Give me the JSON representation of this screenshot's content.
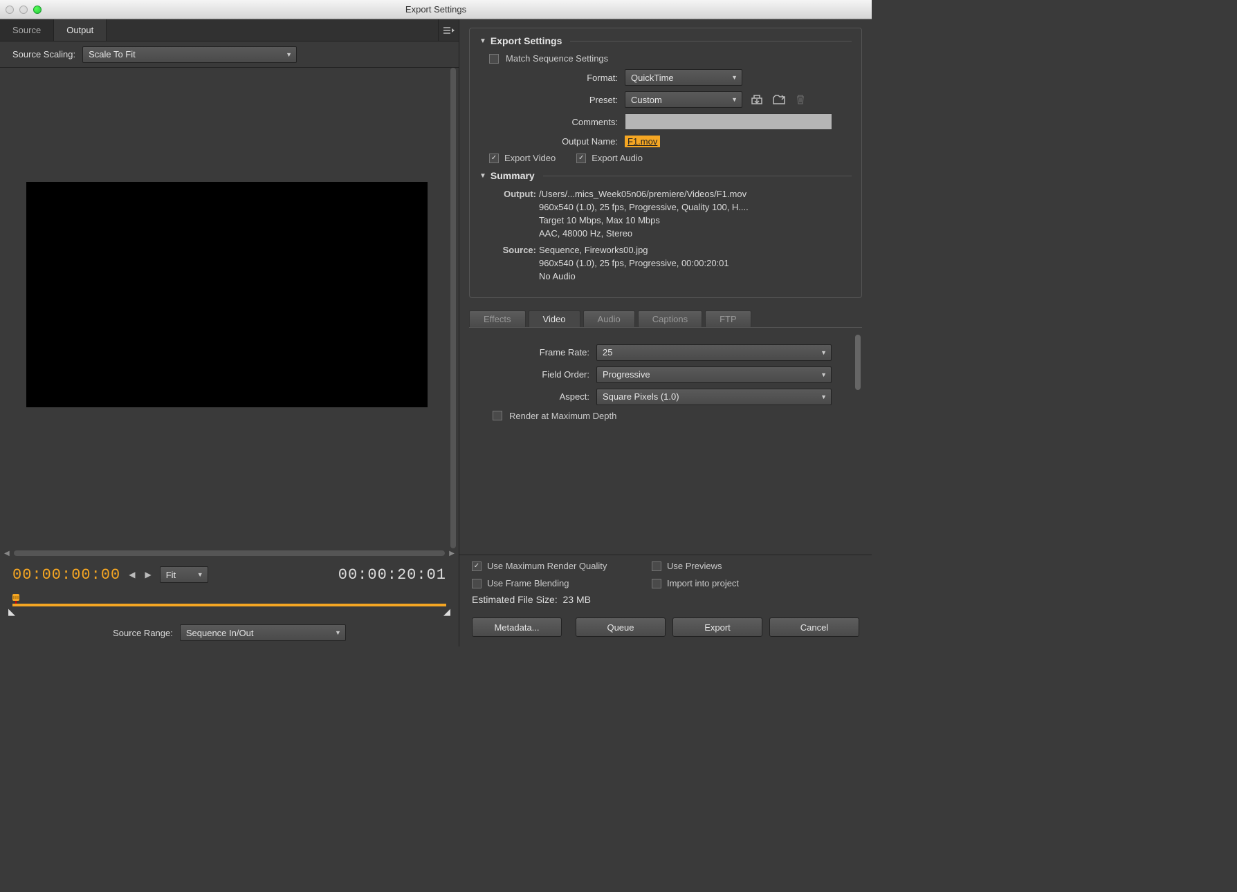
{
  "window": {
    "title": "Export Settings"
  },
  "left": {
    "tabs": {
      "source": "Source",
      "output": "Output"
    },
    "scaling_label": "Source Scaling:",
    "scaling_value": "Scale To Fit",
    "current_time": "00:00:00:00",
    "duration": "00:00:20:01",
    "fit_label": "Fit",
    "source_range_label": "Source Range:",
    "source_range_value": "Sequence In/Out"
  },
  "export": {
    "section_title": "Export Settings",
    "match_sequence": "Match Sequence Settings",
    "format_label": "Format:",
    "format_value": "QuickTime",
    "preset_label": "Preset:",
    "preset_value": "Custom",
    "comments_label": "Comments:",
    "comments_value": "",
    "output_name_label": "Output Name:",
    "output_name_value": "F1.mov",
    "export_video": "Export Video",
    "export_audio": "Export Audio"
  },
  "summary": {
    "title": "Summary",
    "output_label": "Output:",
    "output_lines": [
      "/Users/...mics_Week05n06/premiere/Videos/F1.mov",
      "960x540 (1.0), 25 fps, Progressive, Quality 100, H....",
      "Target 10 Mbps, Max 10 Mbps",
      "AAC, 48000 Hz, Stereo"
    ],
    "source_label": "Source:",
    "source_lines": [
      "Sequence, Fireworks00.jpg",
      "960x540 (1.0), 25 fps, Progressive, 00:00:20:01",
      "No Audio"
    ]
  },
  "param_tabs": {
    "effects": "Effects",
    "video": "Video",
    "audio": "Audio",
    "captions": "Captions",
    "ftp": "FTP"
  },
  "video": {
    "frame_rate_label": "Frame Rate:",
    "frame_rate_value": "25",
    "field_order_label": "Field Order:",
    "field_order_value": "Progressive",
    "aspect_label": "Aspect:",
    "aspect_value": "Square Pixels (1.0)",
    "render_max_depth": "Render at Maximum Depth"
  },
  "bottom": {
    "use_max_quality": "Use Maximum Render Quality",
    "use_previews": "Use Previews",
    "use_frame_blending": "Use Frame Blending",
    "import_project": "Import into project",
    "est_label": "Estimated File Size:",
    "est_value": "23 MB"
  },
  "buttons": {
    "metadata": "Metadata...",
    "queue": "Queue",
    "export": "Export",
    "cancel": "Cancel"
  }
}
